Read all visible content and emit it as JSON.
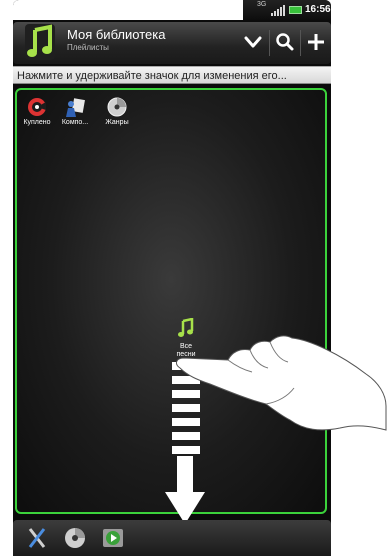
{
  "status_bar": {
    "network": "3G",
    "time": "16:56",
    "battery_color": "#38c23b"
  },
  "header": {
    "title": "Моя библиотека",
    "subtitle": "Плейлисты",
    "icons": [
      "music-note-icon",
      "chevron-down-icon",
      "search-icon",
      "plus-icon"
    ]
  },
  "hint": {
    "text": "Нажмите и удерживайте значок для изменения его..."
  },
  "tiles": [
    {
      "label": "Куплено",
      "icon": "purchased-icon"
    },
    {
      "label": "Компо...",
      "icon": "composer-icon"
    },
    {
      "label": "Жанры",
      "icon": "genres-icon"
    }
  ],
  "dragging_tile": {
    "label_line1": "Все",
    "label_line2": "песни",
    "icon": "music-note-icon"
  },
  "bottom_bar": {
    "icons": [
      "tools-icon",
      "cd-icon",
      "podcast-icon"
    ]
  },
  "colors": {
    "accent": "#3bd23b",
    "background": "#0b0b0b"
  }
}
